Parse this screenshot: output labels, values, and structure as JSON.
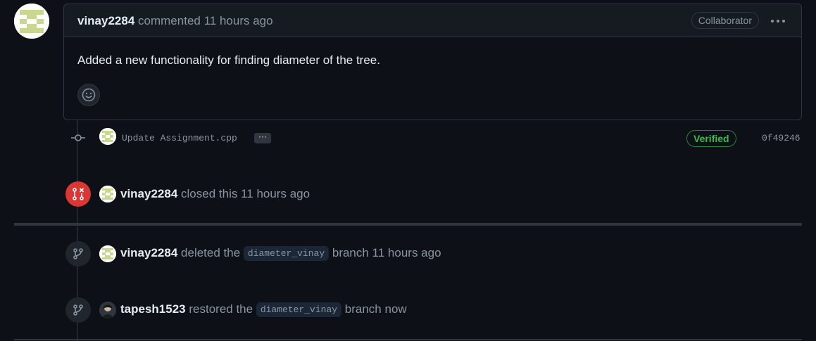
{
  "comment": {
    "author": "vinay2284",
    "action": "commented",
    "time": "11 hours ago",
    "role_badge": "Collaborator",
    "menu_icon": "kebab-icon",
    "body": "Added a new functionality for finding diameter of the tree.",
    "reaction_icon": "smiley-icon"
  },
  "commit": {
    "message": "Update Assignment.cpp",
    "expand_label": "···",
    "verified_label": "Verified",
    "sha": "0f49246"
  },
  "closed_event": {
    "author": "vinay2284",
    "text": "closed this 11 hours ago"
  },
  "deleted_event": {
    "author": "vinay2284",
    "prefix": "deleted the",
    "branch": "diameter_vinay",
    "suffix": "branch 11 hours ago"
  },
  "restored_event": {
    "author": "tapesh1523",
    "prefix": "restored the",
    "branch": "diameter_vinay",
    "suffix": "branch now"
  },
  "colors": {
    "background": "#0d1117",
    "closed_red": "#da3633",
    "verified_green": "#3fb950",
    "avatar_green": "#c8d98f"
  }
}
